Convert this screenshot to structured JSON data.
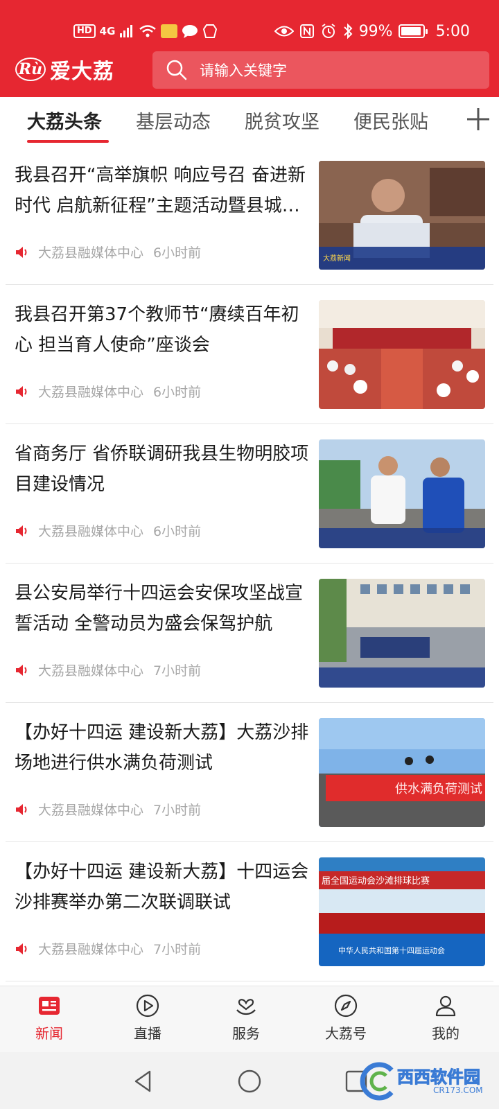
{
  "status_bar": {
    "left_badges": [
      "HD",
      "4G"
    ],
    "battery": "99%",
    "time": "5:00"
  },
  "app": {
    "logo_mark": "Rù",
    "logo_text": "爱大荔"
  },
  "search": {
    "placeholder": "请输入关键字"
  },
  "tabs": [
    {
      "label": "大荔头条",
      "active": true
    },
    {
      "label": "基层动态",
      "active": false
    },
    {
      "label": "脱贫攻坚",
      "active": false
    },
    {
      "label": "便民张贴",
      "active": false
    }
  ],
  "news": [
    {
      "title": "我县召开“高举旗帜 响应号召 奋进新时代 启航新征程”主题活动暨县城经济社会高质量发展务虚研讨会",
      "source": "大荔县融媒体中心",
      "time": "6小时前"
    },
    {
      "title": "我县召开第37个教师节“赓续百年初心 担当育人使命”座谈会",
      "source": "大荔县融媒体中心",
      "time": "6小时前"
    },
    {
      "title": "省商务厅 省侨联调研我县生物明胶项目建设情况",
      "source": "大荔县融媒体中心",
      "time": "6小时前"
    },
    {
      "title": "县公安局举行十四运会安保攻坚战宣誓活动 全警动员为盛会保驾护航",
      "source": "大荔县融媒体中心",
      "time": "7小时前"
    },
    {
      "title": "【办好十四运 建设新大荔】大荔沙排场地进行供水满负荷测试",
      "source": "大荔县融媒体中心",
      "time": "7小时前"
    },
    {
      "title": "【办好十四运 建设新大荔】十四运会沙排赛举办第二次联调联试",
      "source": "大荔县融媒体中心",
      "time": "7小时前"
    }
  ],
  "thumb_captions": {
    "t1": "大荔新闻",
    "t5": "供水满负荷测试",
    "t6a": "届全国运动会沙滩排球比赛",
    "t6b": "中华人民共和国第十四届运动会"
  },
  "bottom_nav": [
    {
      "label": "新闻",
      "icon": "news-icon",
      "active": true
    },
    {
      "label": "直播",
      "icon": "live-play-icon",
      "active": false
    },
    {
      "label": "服务",
      "icon": "service-icon",
      "active": false
    },
    {
      "label": "大荔号",
      "icon": "compass-icon",
      "active": false
    },
    {
      "label": "我的",
      "icon": "profile-icon",
      "active": false
    }
  ],
  "watermark": {
    "text": "西西软件园",
    "sub": "CR173.COM"
  },
  "colors": {
    "brand_red": "#e62731",
    "meta_gray": "#a7a7a7",
    "active_tab": "#222222"
  }
}
